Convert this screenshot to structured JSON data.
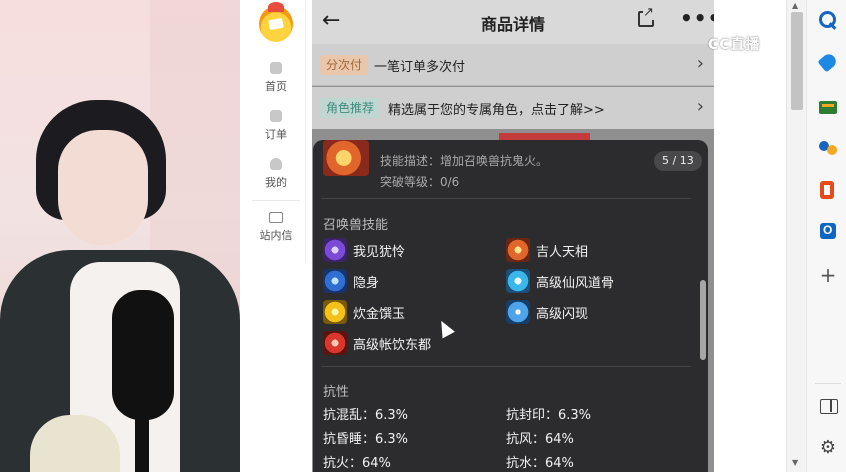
{
  "nav": {
    "items": [
      {
        "label": "首页"
      },
      {
        "label": "订单"
      },
      {
        "label": "我的"
      },
      {
        "label": "站内信"
      }
    ]
  },
  "header": {
    "title": "商品详情"
  },
  "rows": [
    {
      "tag": "分次付",
      "text": "一笔订单多次付"
    },
    {
      "tag": "角色推荐",
      "text": "精选属于您的专属角色，点击了解>>"
    }
  ],
  "card": {
    "skill_desc": "技能描述：增加召唤兽抗鬼火。",
    "breakthrough": "突破等级：0/6",
    "counter": "5 / 13",
    "summon_title": "召唤兽技能",
    "skills": [
      {
        "name": "我见犹怜",
        "icon": "skill-icon-purple"
      },
      {
        "name": "吉人天相",
        "icon": "skill-icon-fire"
      },
      {
        "name": "隐身",
        "icon": "skill-icon-blue"
      },
      {
        "name": "高级仙风道骨",
        "icon": "skill-icon-cyan"
      },
      {
        "name": "炊金馔玉",
        "icon": "skill-icon-gold"
      },
      {
        "name": "高级闪现",
        "icon": "skill-icon-lightblue"
      },
      {
        "name": "高级帐饮东都",
        "icon": "skill-icon-red"
      }
    ],
    "resist_title": "抗性",
    "resistances": [
      {
        "text": "抗混乱：6.3%"
      },
      {
        "text": "抗封印：6.3%"
      },
      {
        "text": "抗昏睡：6.3%"
      },
      {
        "text": "抗风：64%"
      },
      {
        "text": "抗火：64%"
      },
      {
        "text": "抗水：64%"
      }
    ]
  },
  "watermark": "CC直播",
  "colors": {
    "tag_split_bg": "#e8c7aa",
    "tag_role_bg": "#bfd6d1",
    "card_bg": "#2c2c2e",
    "accent_blue": "#1565c0"
  }
}
